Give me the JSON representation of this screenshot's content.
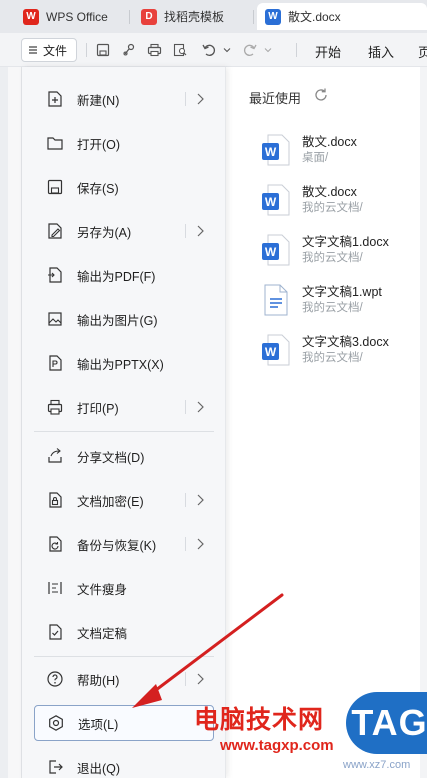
{
  "tabs": [
    {
      "label": "WPS Office",
      "icon": "wps-logo-icon",
      "color": "#e0261c",
      "glyph": "W"
    },
    {
      "label": "找稻壳模板",
      "icon": "docer-logo-icon",
      "color": "#e8413c",
      "glyph": "D"
    },
    {
      "label": "散文.docx",
      "icon": "word-doc-icon",
      "color": "#2b6fd6",
      "glyph": "W"
    }
  ],
  "toolbar": {
    "file_label": "文件",
    "start_label": "开始",
    "insert_label": "插入",
    "partial_label": "页"
  },
  "menu": {
    "items": [
      {
        "label": "新建(N)",
        "icon": "new-file-icon",
        "arrow": true
      },
      {
        "label": "打开(O)",
        "icon": "folder-open-icon",
        "arrow": false
      },
      {
        "label": "保存(S)",
        "icon": "save-icon",
        "arrow": false
      },
      {
        "label": "另存为(A)",
        "icon": "save-as-icon",
        "arrow": true
      },
      {
        "label": "输出为PDF(F)",
        "icon": "export-pdf-icon",
        "arrow": false
      },
      {
        "label": "输出为图片(G)",
        "icon": "export-image-icon",
        "arrow": false
      },
      {
        "label": "输出为PPTX(X)",
        "icon": "export-pptx-icon",
        "arrow": false
      },
      {
        "label": "打印(P)",
        "icon": "print-icon",
        "arrow": true
      },
      {
        "label": "分享文档(D)",
        "icon": "share-icon",
        "arrow": false
      },
      {
        "label": "文档加密(E)",
        "icon": "lock-icon",
        "arrow": true
      },
      {
        "label": "备份与恢复(K)",
        "icon": "backup-icon",
        "arrow": true
      },
      {
        "label": "文件瘦身",
        "icon": "slim-file-icon",
        "arrow": false
      },
      {
        "label": "文档定稿",
        "icon": "finalize-icon",
        "arrow": false
      },
      {
        "label": "帮助(H)",
        "icon": "help-icon",
        "arrow": true
      },
      {
        "label": "选项(L)",
        "icon": "options-icon",
        "arrow": false
      },
      {
        "label": "退出(Q)",
        "icon": "exit-icon",
        "arrow": false
      }
    ]
  },
  "recent": {
    "title": "最近使用",
    "files": [
      {
        "name": "散文.docx",
        "path": "桌面/",
        "type": "docx"
      },
      {
        "name": "散文.docx",
        "path": "我的云文档/",
        "type": "docx"
      },
      {
        "name": "文字文稿1.docx",
        "path": "我的云文档/",
        "type": "docx"
      },
      {
        "name": "文字文稿1.wpt",
        "path": "我的云文档/",
        "type": "wpt"
      },
      {
        "name": "文字文稿3.docx",
        "path": "我的云文档/",
        "type": "docx"
      }
    ]
  },
  "watermark": {
    "text": "电脑技术网",
    "url": "www.tagxp.com",
    "logo": "TAG",
    "url2": "www.xz7.com"
  },
  "colors": {
    "accent_blue": "#2b6fd6",
    "annotation_red": "#d42020",
    "selected_border": "#8aa3c8"
  }
}
